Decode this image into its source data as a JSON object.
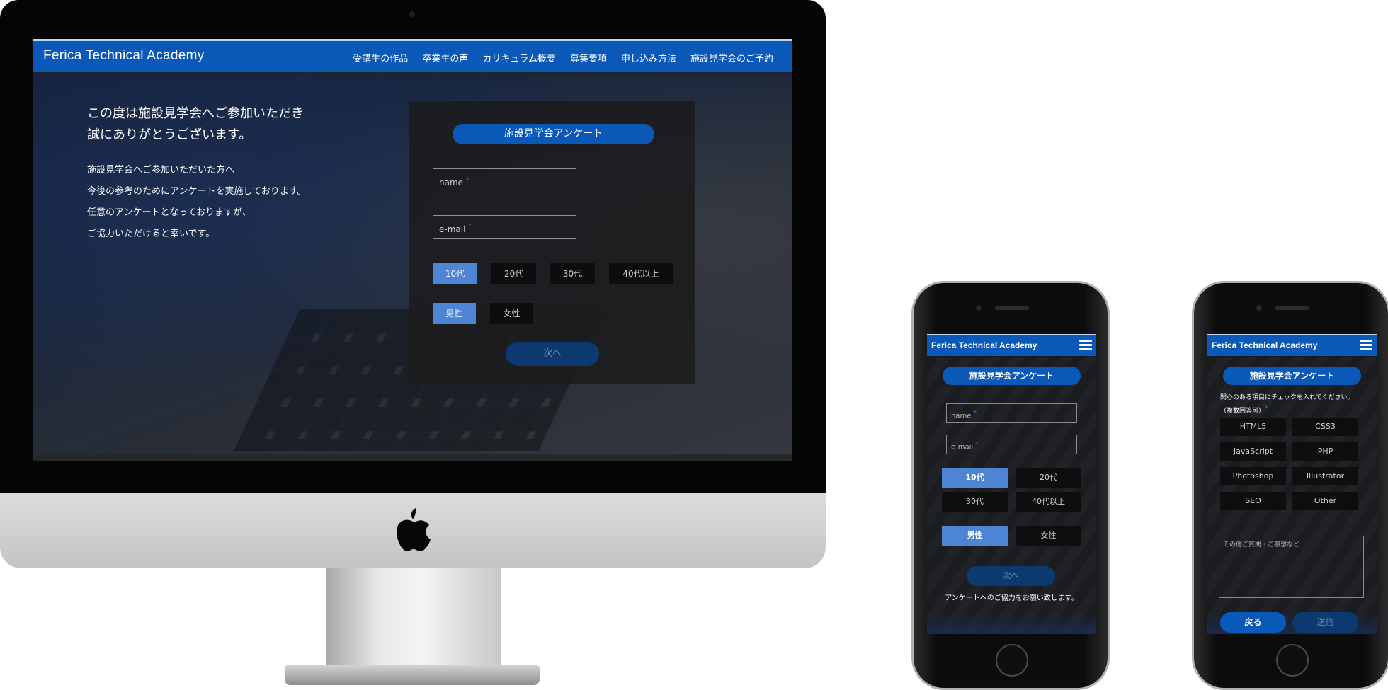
{
  "desktop": {
    "brand": "Ferica Technical Academy",
    "nav": [
      "受講生の作品",
      "卒業生の声",
      "カリキュラム概要",
      "募集要項",
      "申し込み方法",
      "施設見学会のご予約"
    ],
    "hero": {
      "title_line1": "この度は施設見学会へご参加いただき",
      "title_line2": "誠にありがとうございます。",
      "body_line1": "施設見学会へご参加いただいた方へ",
      "body_line2": "今後の参考のためにアンケートを実施しております。",
      "body_line3": "任意のアンケートとなっておりますが、",
      "body_line4": "ご協力いただけると幸いです。"
    },
    "form": {
      "title": "施設見学会アンケート",
      "name_placeholder": "name",
      "email_placeholder": "e-mail",
      "required_mark": "*",
      "ages": [
        "10代",
        "20代",
        "30代",
        "40代以上"
      ],
      "selected_age": "10代",
      "genders": [
        "男性",
        "女性"
      ],
      "selected_gender": "男性",
      "next_label": "次へ"
    }
  },
  "phone1": {
    "brand": "Ferica Technical Academy",
    "form_title": "施設見学会アンケート",
    "name_placeholder": "name",
    "email_placeholder": "e-mail",
    "required_mark": "*",
    "ages": [
      "10代",
      "20代",
      "30代",
      "40代以上"
    ],
    "genders": [
      "男性",
      "女性"
    ],
    "next_label": "次へ",
    "note": "アンケートへのご協力をお願い致します。"
  },
  "phone2": {
    "brand": "Ferica Technical Academy",
    "form_title": "施設見学会アンケート",
    "question_line1": "関心のある項目にチェックを入れてください。",
    "question_line2": "（複数回答可）",
    "required_mark": "*",
    "interests": [
      "HTML5",
      "CSS3",
      "JavaScript",
      "PHP",
      "Photoshop",
      "Illustrator",
      "SEO",
      "Other"
    ],
    "textarea_placeholder": "その他ご質問・ご感想など",
    "back_label": "戻る",
    "send_label": "送信"
  },
  "colors": {
    "brand_blue": "#0a58b8",
    "selected_option": "#4d84d4",
    "disabled_button": "#0c3a70"
  }
}
